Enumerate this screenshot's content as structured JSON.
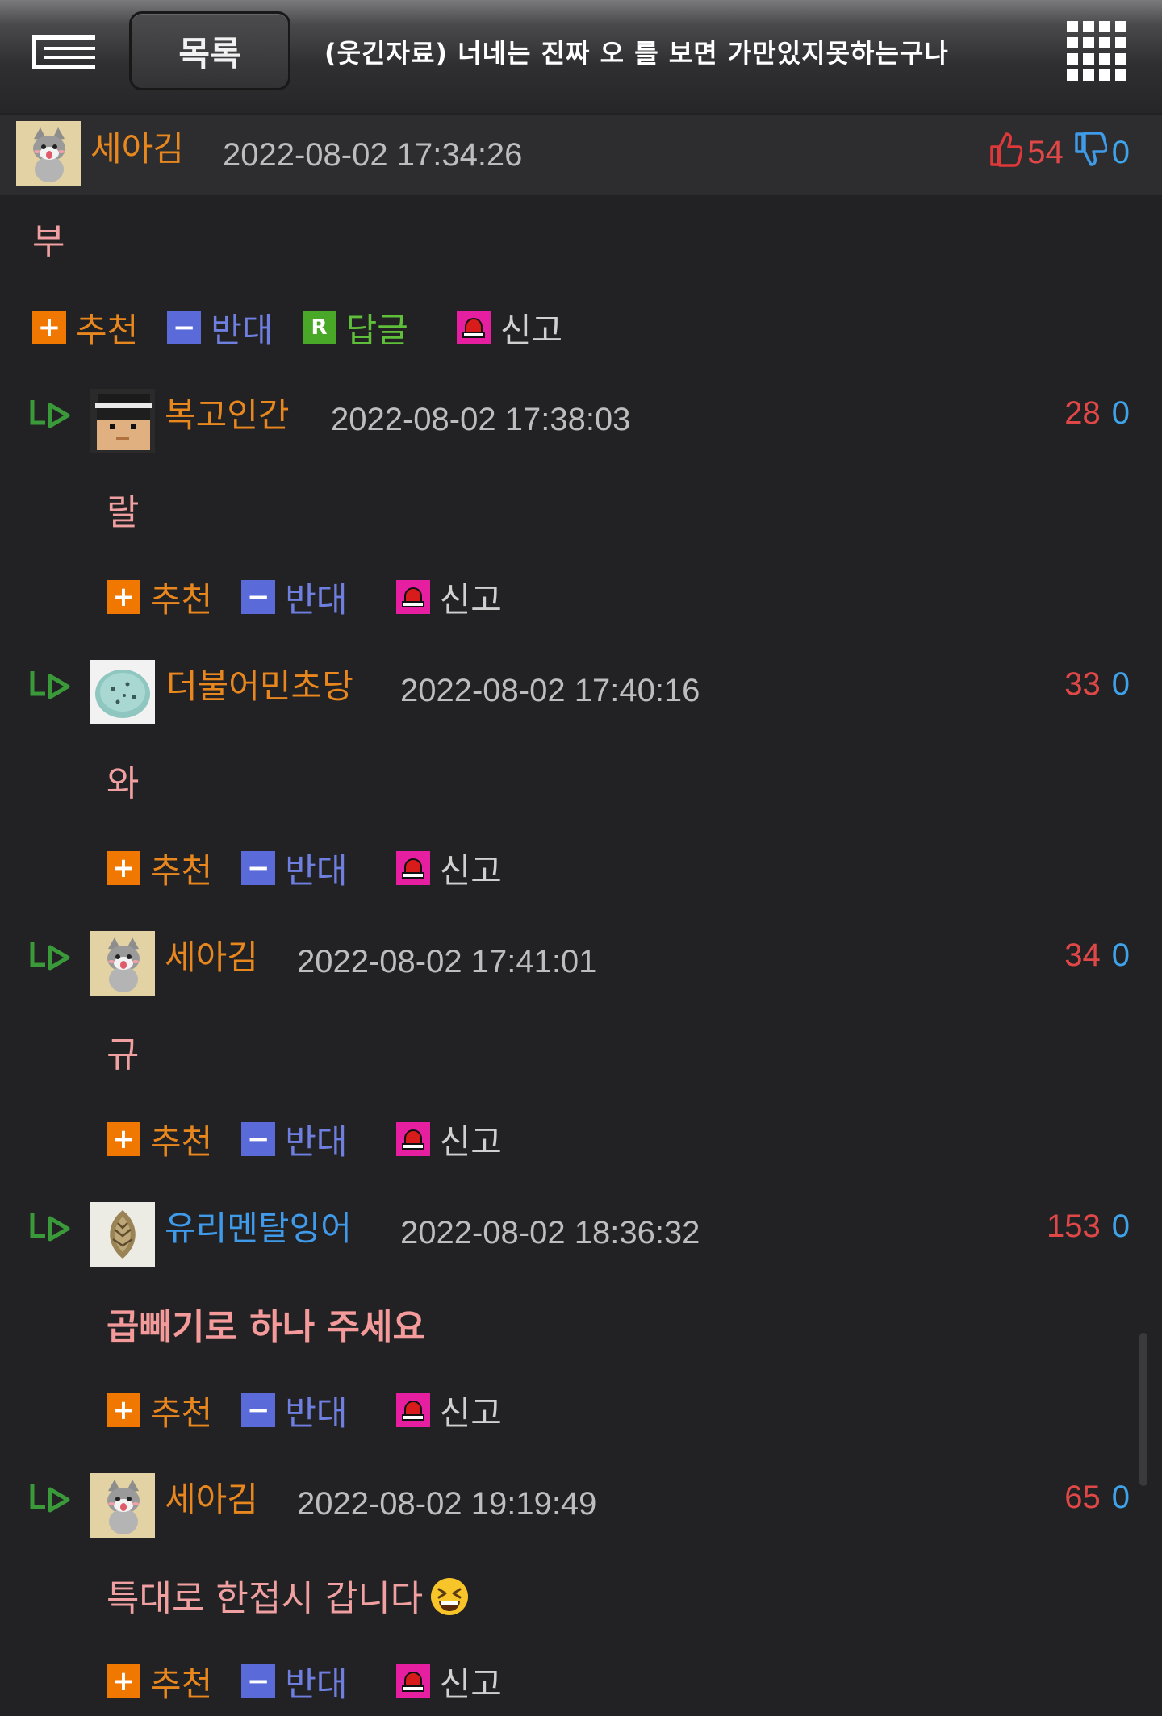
{
  "header": {
    "list_label": "목록",
    "title": "(웃긴자료) 너네는 진짜 오 를 보면 가만있지못하는구나"
  },
  "comments": [
    {
      "nick": "세아김",
      "nick_color": "orange",
      "avatar": "cat-avatar",
      "timestamp": "2022-08-02 17:34:26",
      "up": "54",
      "down": "0",
      "body": "부",
      "reply_label": "답글"
    },
    {
      "nick": "복고인간",
      "nick_color": "orange",
      "avatar": "pixel-man-avatar",
      "timestamp": "2022-08-02 17:38:03",
      "up": "28",
      "down": "0",
      "body": "랄"
    },
    {
      "nick": "더불어민초당",
      "nick_color": "orange",
      "avatar": "mint-ball-avatar",
      "timestamp": "2022-08-02 17:40:16",
      "up": "33",
      "down": "0",
      "body": "와"
    },
    {
      "nick": "세아김",
      "nick_color": "orange",
      "avatar": "cat-avatar",
      "timestamp": "2022-08-02 17:41:01",
      "up": "34",
      "down": "0",
      "body": "규"
    },
    {
      "nick": "유리멘탈잉어",
      "nick_color": "blue",
      "avatar": "pinecone-avatar",
      "timestamp": "2022-08-02 18:36:32",
      "up": "153",
      "down": "0",
      "body": "곱빼기로 하나 주세요"
    },
    {
      "nick": "세아김",
      "nick_color": "orange",
      "avatar": "cat-avatar",
      "timestamp": "2022-08-02 19:19:49",
      "up": "65",
      "down": "0",
      "body": "특대로 한접시 갑니다"
    }
  ],
  "actions": {
    "recommend": "추천",
    "oppose": "반대",
    "report": "신고"
  },
  "icons": {
    "menu": "menu-icon",
    "grid": "grid-icon",
    "reply_arrow": "reply-arrow-icon",
    "thumbs_up": "thumbs-up-icon",
    "thumbs_down": "thumbs-down-icon",
    "report": "siren-icon",
    "emoji": "laughing-emoji"
  },
  "colors": {
    "background": "#222224",
    "nick_orange": "#e8871e",
    "nick_blue": "#3f9aea",
    "upvote": "#e04848",
    "downvote": "#3fa3ea",
    "recommend": "#f07800",
    "oppose": "#5a6ad8",
    "reply": "#4aa828",
    "report": "#e61ea0"
  }
}
